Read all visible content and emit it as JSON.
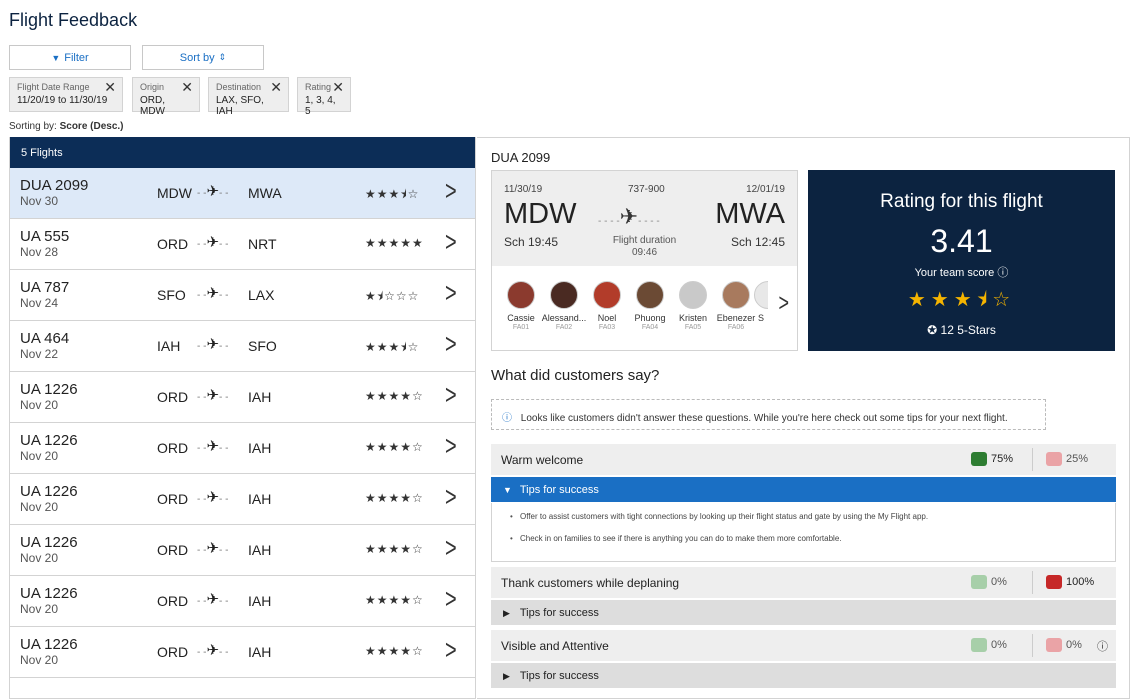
{
  "page": {
    "title": "Flight Feedback"
  },
  "toolbar": {
    "filter_label": "Filter",
    "sort_label": "Sort by"
  },
  "chips": [
    {
      "key": "Flight Date Range",
      "value": "11/20/19 to 11/30/19"
    },
    {
      "key": "Origin",
      "value": "ORD, MDW"
    },
    {
      "key": "Destination",
      "value": "LAX, SFO, IAH"
    },
    {
      "key": "Rating",
      "value": "1, 3, 4, 5"
    }
  ],
  "sorting": {
    "prefix": "Sorting by:",
    "value": "Score (Desc.)"
  },
  "list": {
    "header": "5 Flights",
    "flights": [
      {
        "flight": "DUA 2099",
        "date": "Nov 30",
        "origin": "MDW",
        "dest": "MWA",
        "stars": "★★★⯨☆",
        "rating": 3.5
      },
      {
        "flight": "UA 555",
        "date": "Nov 28",
        "origin": "ORD",
        "dest": "NRT",
        "stars": "★★★★★",
        "rating": 5
      },
      {
        "flight": "UA 787",
        "date": "Nov 24",
        "origin": "SFO",
        "dest": "LAX",
        "stars": "★⯨☆☆☆",
        "rating": 1.5
      },
      {
        "flight": "UA 464",
        "date": "Nov 22",
        "origin": "IAH",
        "dest": "SFO",
        "stars": "★★★⯨☆",
        "rating": 3.5
      },
      {
        "flight": "UA 1226",
        "date": "Nov 20",
        "origin": "ORD",
        "dest": "IAH",
        "stars": "★★★★☆",
        "rating": 4
      },
      {
        "flight": "UA 1226",
        "date": "Nov 20",
        "origin": "ORD",
        "dest": "IAH",
        "stars": "★★★★☆",
        "rating": 4
      },
      {
        "flight": "UA 1226",
        "date": "Nov 20",
        "origin": "ORD",
        "dest": "IAH",
        "stars": "★★★★☆",
        "rating": 4
      },
      {
        "flight": "UA 1226",
        "date": "Nov 20",
        "origin": "ORD",
        "dest": "IAH",
        "stars": "★★★★☆",
        "rating": 4
      },
      {
        "flight": "UA 1226",
        "date": "Nov 20",
        "origin": "ORD",
        "dest": "IAH",
        "stars": "★★★★☆",
        "rating": 4
      },
      {
        "flight": "UA 1226",
        "date": "Nov 20",
        "origin": "ORD",
        "dest": "IAH",
        "stars": "★★★★☆",
        "rating": 4
      }
    ]
  },
  "detail": {
    "flight": "DUA 2099",
    "dep_date": "11/30/19",
    "aircraft": "737-900",
    "arr_date": "12/01/19",
    "origin": "MDW",
    "dest": "MWA",
    "dep_time": "Sch 19:45",
    "arr_time": "Sch 12:45",
    "duration_label": "Flight duration",
    "duration": "09:46",
    "crew": [
      {
        "name": "Cassie",
        "id": "FA01",
        "color": "#8b3a2e"
      },
      {
        "name": "Alessand...",
        "id": "FA02",
        "color": "#4a2a22"
      },
      {
        "name": "Noel",
        "id": "FA03",
        "color": "#b23c2a"
      },
      {
        "name": "Phuong",
        "id": "FA04",
        "color": "#6b4a34"
      },
      {
        "name": "Kristen",
        "id": "FA05",
        "color": "#c9c9c9"
      },
      {
        "name": "Ebenezer",
        "id": "FA06",
        "color": "#a87a5e"
      }
    ],
    "crew_more_name": "S",
    "rating": {
      "title": "Rating for this flight",
      "score": "3.41",
      "sub": "Your team score",
      "stars": "★★★⯨☆",
      "five_stars": "12 5-Stars"
    }
  },
  "feedback": {
    "title": "What did customers say?",
    "notice": "Looks like customers didn't answer these questions. While you're here check out some tips for your next flight.",
    "questions": [
      {
        "label": "Warm welcome",
        "up": "75%",
        "down": "25%"
      },
      {
        "label": "Thank customers while deplaning",
        "up": "0%",
        "down": "100%"
      },
      {
        "label": "Visible and Attentive",
        "up": "0%",
        "down": "0%"
      }
    ],
    "tips_label": "Tips for success",
    "tips": [
      "Offer to assist customers with tight connections by looking up their flight status and gate by using the My Flight app.",
      "Check in on families to see if there is anything you can do to make them more comfortable."
    ]
  },
  "colors": {
    "brand_navy": "#0c2340",
    "accent_blue": "#1a6fc4",
    "star_gold": "#f5b400",
    "thumb_up": "#2e7d32",
    "thumb_down": "#c62828"
  }
}
